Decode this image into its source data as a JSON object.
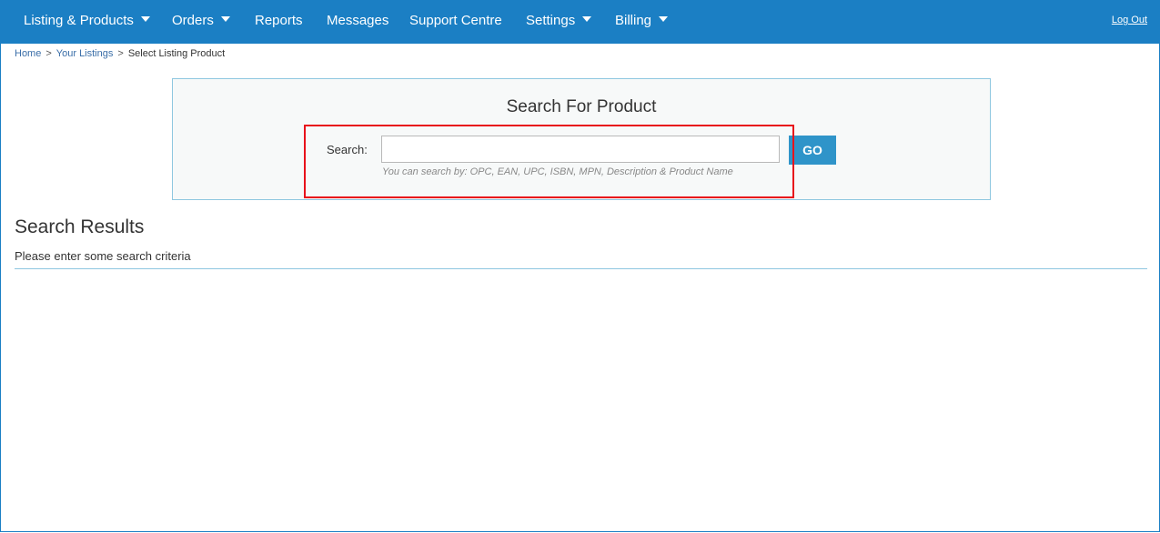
{
  "nav": {
    "items": [
      {
        "label": "Listing & Products",
        "dropdown": true
      },
      {
        "label": "Orders",
        "dropdown": true
      },
      {
        "label": "Reports",
        "dropdown": false
      },
      {
        "label": "Messages",
        "dropdown": false
      },
      {
        "label": "Support Centre",
        "dropdown": false
      },
      {
        "label": "Settings",
        "dropdown": true
      },
      {
        "label": "Billing",
        "dropdown": true
      }
    ],
    "logout_label": "Log Out"
  },
  "breadcrumb": {
    "home": "Home",
    "listings": "Your Listings",
    "current": "Select Listing Product",
    "separator": ">"
  },
  "search": {
    "title": "Search For Product",
    "label": "Search:",
    "value": "",
    "go_label": "GO",
    "hint": "You can search by: OPC, EAN, UPC, ISBN, MPN, Description & Product Name"
  },
  "results": {
    "title": "Search Results",
    "message": "Please enter some search criteria"
  },
  "colors": {
    "nav_background": "#1b7fc4",
    "go_button": "#2f94c9",
    "highlight": "#e8121b"
  }
}
